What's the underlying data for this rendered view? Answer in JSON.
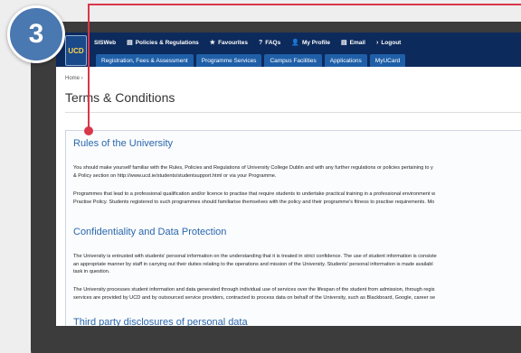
{
  "step_number": "3",
  "logo_text": "UCD",
  "topnav": [
    {
      "icon": "",
      "label": "SISWeb"
    },
    {
      "icon": "▤",
      "label": "Policies & Regulations"
    },
    {
      "icon": "★",
      "label": "Favourites"
    },
    {
      "icon": "?",
      "label": "FAQs"
    },
    {
      "icon": "👤",
      "label": "My Profile"
    },
    {
      "icon": "▤",
      "label": "Email"
    },
    {
      "icon": "›",
      "label": "Logout"
    }
  ],
  "tabs": [
    "Registration, Fees & Assessment",
    "Programme Services",
    "Campus Facilities",
    "Applications",
    "MyUCard"
  ],
  "breadcrumb": "Home ›",
  "page_title": "Terms & Conditions",
  "sections": [
    {
      "heading": "Rules of the University",
      "paragraphs": [
        [
          "You should make yourself familiar with the Rules, Policies and Regulations of University College Dublin and with any further regulations or policies pertaining to y",
          "& Policy section on http://www.ucd.ie/students/studentsupport.html or via your Programme."
        ],
        [
          "Programmes that lead to a professional qualification and/or licence to practise that require students to undertake practical training in a professional environment w",
          "Practise Policy. Students registered to such programmes should familiarise themselves with the policy and their programme's fitness to practise requirements. Mo"
        ]
      ]
    },
    {
      "heading": "Confidentiality and Data Protection",
      "paragraphs": [
        [
          "The University is entrusted with students' personal information on the understanding that it is treated in strict confidence. The use of student information is consiste",
          "an appropriate manner by staff in carrying out their duties relating to the operations and mission of the University. Students' personal information is made availabl",
          "task in question."
        ],
        [
          "The University processes student information and data generated through individual use of services over the lifespan of the student from admission, through regis",
          "services are provided by UCD and by outsourced service providers, contracted to process data on behalf of the University, such as Blackboard, Google, career se"
        ]
      ]
    },
    {
      "heading": "Third party disclosures of personal data",
      "paragraphs": []
    }
  ]
}
